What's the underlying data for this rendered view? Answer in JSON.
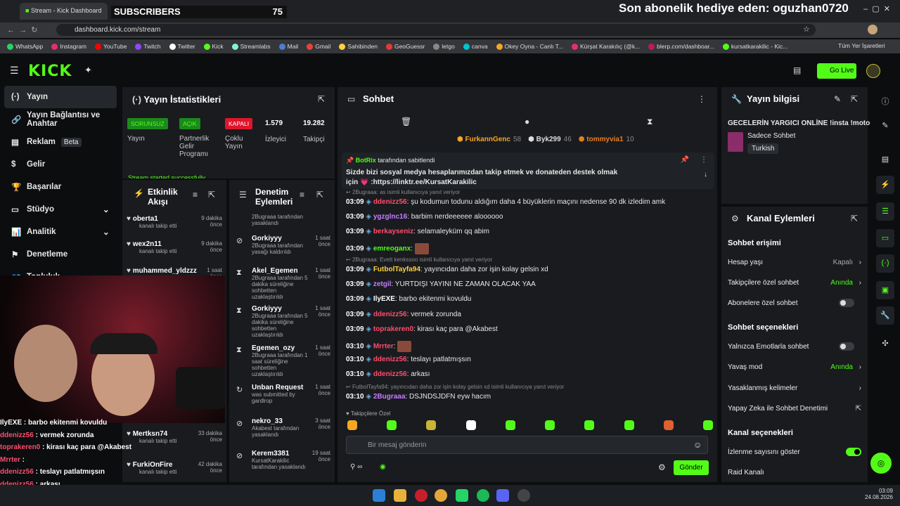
{
  "browser": {
    "tab_title": "Stream - Kick Dashboard",
    "url": "dashboard.kick.com/stream",
    "bookmarks": [
      "WhatsApp",
      "Instagram",
      "YouTube",
      "Twitch",
      "Twitter",
      "Kick",
      "Streamlabs",
      "Mail",
      "Gmail",
      "Sahibinden",
      "GeoGuessr",
      "letgo",
      "canva",
      "Okey Oyna - Canlı T...",
      "Kürşat Karakılıç (@k...",
      "blerp.com/dashboar...",
      "kursatkarakilic - Kic..."
    ],
    "all_bookmarks": "Tüm Yer İşaretleri"
  },
  "overlay": {
    "subscribers_label": "SUBSCRIBERS",
    "subscribers_count": "75",
    "last_gift": "Son abonelik hediye eden: oguzhan0720"
  },
  "header": {
    "logo": "KICK",
    "go_live": "Go Live"
  },
  "nav": [
    {
      "label": "Yayın"
    },
    {
      "label": "Yayın Bağlantısı ve Anahtar"
    },
    {
      "label": "Reklam",
      "badge": "Beta"
    },
    {
      "label": "Gelir"
    },
    {
      "label": "Başarılar"
    },
    {
      "label": "Stüdyo"
    },
    {
      "label": "Analitik"
    },
    {
      "label": "Denetleme"
    },
    {
      "label": "Topluluk"
    }
  ],
  "stats": {
    "title": "Yayın İstatistikleri",
    "tags": [
      "SORUNSUZ",
      "AÇIK",
      "KAPALI"
    ],
    "labels": [
      "Yayın",
      "Partnerlik Gelir Programı",
      "Çoklu Yayın",
      "İzleyici",
      "Takipçi"
    ],
    "viewers": "1.579",
    "followers": "19.282",
    "toast": "Stream started successfully"
  },
  "activity": {
    "title": "Etkinlik Akışı",
    "items": [
      {
        "name": "oberta1",
        "sub": "kanalı takip etti",
        "time": "9 dakika önce"
      },
      {
        "name": "wex2n11",
        "sub": "kanalı takip etti",
        "time": "9 dakika önce"
      },
      {
        "name": "muhammed_yldzzz",
        "sub": "kanalı takip etti",
        "time": "1 saat önce"
      },
      {
        "name": "Mertksn74",
        "sub": "kanalı takip etti",
        "time": "33 dakika önce"
      },
      {
        "name": "FurkiOnFire",
        "sub": "kanalı takip etti",
        "time": "42 dakika önce"
      }
    ]
  },
  "moderation": {
    "title": "Denetim Eylemleri",
    "items": [
      {
        "name": "",
        "detail": "2Bugraaa tarafından yasaklandı",
        "time": ""
      },
      {
        "name": "Gorkiyyy",
        "detail": "2Bugraaa tarafından yasağı kaldırıldı",
        "time": "1 saat önce"
      },
      {
        "name": "Akel_Egemen",
        "detail": "2Bugraaa tarafından 5 dakika süreliğine sohbetten uzaklaştırıldı",
        "time": "1 saat önce"
      },
      {
        "name": "Gorkiyyy",
        "detail": "2Bugraaa tarafından 5 dakika süreliğine sohbetten uzaklaştırıldı",
        "time": "1 saat önce"
      },
      {
        "name": "Egemen_ozy",
        "detail": "2Bugraaa tarafından 1 saat süreliğine sohbetten uzaklaştırıldı",
        "time": "1 saat önce"
      },
      {
        "name": "Unban Request",
        "detail": "was submitted by gardlrop",
        "time": "1 saat önce"
      },
      {
        "name": "nekro_33",
        "detail": "Akabest tarafından yasaklandı",
        "time": "3 saat önce"
      },
      {
        "name": "Kerem3381",
        "detail": "KursatKarakilic tarafından yasaklandı",
        "time": "19 saat önce"
      }
    ]
  },
  "overlay_chat": [
    {
      "u": "IlyEXE",
      "m": "barbo ekitenmi kovuldu"
    },
    {
      "u": "ddenizz56",
      "m": "vermek zorunda"
    },
    {
      "u": "toprakeren0",
      "m": "kirası kaç para @Akabest"
    },
    {
      "u": "Mrrter",
      "m": ""
    },
    {
      "u": "ddenizz56",
      "m": "teslayı patlatmışsın"
    },
    {
      "u": "ddenizz56",
      "m": "arkası"
    },
    {
      "u": "a",
      "m": "DSJNDSJDFN eyw hacım"
    }
  ],
  "chat": {
    "title": "Sohbet",
    "top": [
      {
        "name": "FurkannGenc",
        "n": "58"
      },
      {
        "name": "Byk299",
        "n": "46"
      },
      {
        "name": "tommyvia1",
        "n": "10"
      }
    ],
    "pinned": {
      "user": "BotRix",
      "by": "tarafından sabitlendi",
      "text": "Sizde bizi sosyal medya hesaplarımızdan takip etmek ve donateden destek olmak için 💗 :https://linktr.ee/KursatKarakilic"
    },
    "messages": [
      {
        "reply": "2Bugraaa: as isimli kullanıcıya yanıt veriyor",
        "t": "03:09",
        "u": "ddenizz56",
        "c": "#ff4d6d",
        "m": "şu kodumun todunu aldığım daha 4 büyüklerin maçını nedense 90 dk izledim amk"
      },
      {
        "t": "03:09",
        "u": "ygzglnc16",
        "c": "#c77dff",
        "m": "barbim nerdeeeeee aloooooo"
      },
      {
        "t": "03:09",
        "u": "berkayseniz",
        "c": "#ff4d6d",
        "m": "selamaleyküm qq abim"
      },
      {
        "t": "03:09",
        "u": "emreoganx",
        "c": "#53fc18",
        "m": ""
      },
      {
        "reply": "2Bugraaa: Evett kenkssoo isimli kullanıcıya yanıt veriyor",
        "t": "03:09",
        "u": "FutbolTayfa94",
        "c": "#ffd23f",
        "m": "yayıncıdan daha zor işin kolay gelsin xd"
      },
      {
        "t": "03:09",
        "u": "zetgil",
        "c": "#c77dff",
        "m": "YURTDIŞI YAYINI NE ZAMAN OLACAK YAA"
      },
      {
        "t": "03:09",
        "u": "IlyEXE",
        "c": "#ffffff",
        "m": "barbo ekitenmi kovuldu"
      },
      {
        "t": "03:09",
        "u": "ddenizz56",
        "c": "#ff4d6d",
        "m": "vermek zorunda"
      },
      {
        "t": "03:09",
        "u": "toprakeren0",
        "c": "#ff4d6d",
        "m": "kirası kaç para @Akabest"
      },
      {
        "t": "03:10",
        "u": "Mrrter",
        "c": "#ff4d6d",
        "m": ""
      },
      {
        "t": "03:10",
        "u": "ddenizz56",
        "c": "#ff4d6d",
        "m": "teslayı patlatmışsın"
      },
      {
        "t": "03:10",
        "u": "ddenizz56",
        "c": "#ff4d6d",
        "m": "arkası"
      },
      {
        "reply": "FutbolTayfa94: yayıncıdan daha zor işin kolay gelsin xd isimli kullanıcıya yanıt veriyor",
        "t": "03:10",
        "u": "2Bugraaa",
        "c": "#c77dff",
        "m": "DSJNDSJDFN eyw hacım"
      }
    ],
    "followers_only": "Takipçilere Özel",
    "placeholder": "Bir mesaj gönderin",
    "send": "Gönder"
  },
  "info": {
    "title": "Yayın bilgisi",
    "stream_title": "GECELERİN YARGICI ONLİNE !insta !motor",
    "category": "Sadece Sohbet",
    "language": "Turkish"
  },
  "actions": {
    "title": "Kanal Eylemleri",
    "sec1": "Sohbet erişimi",
    "hesap": "Hesap yaşı",
    "hesap_val": "Kapalı",
    "takip": "Takipçilere özel sohbet",
    "takip_val": "Anında",
    "abone": "Abonelere özel sohbet",
    "sec2": "Sohbet seçenekleri",
    "emote": "Yalnızca Emotlarla sohbet",
    "yavas": "Yavaş mod",
    "yavas_val": "Anında",
    "yasak": "Yasaklanmış kelimeler",
    "ai": "Yapay Zeka ile Sohbet Denetimi",
    "sec3": "Kanal seçenekleri",
    "izlenme": "İzlenme sayısını göster",
    "raid": "Raid Kanalı"
  },
  "clock": {
    "time": "03:09",
    "date": "24.08.2026"
  },
  "colors": {
    "accent": "#53fc18",
    "bg": "#0b0d0f",
    "panel": "#191b1f"
  }
}
